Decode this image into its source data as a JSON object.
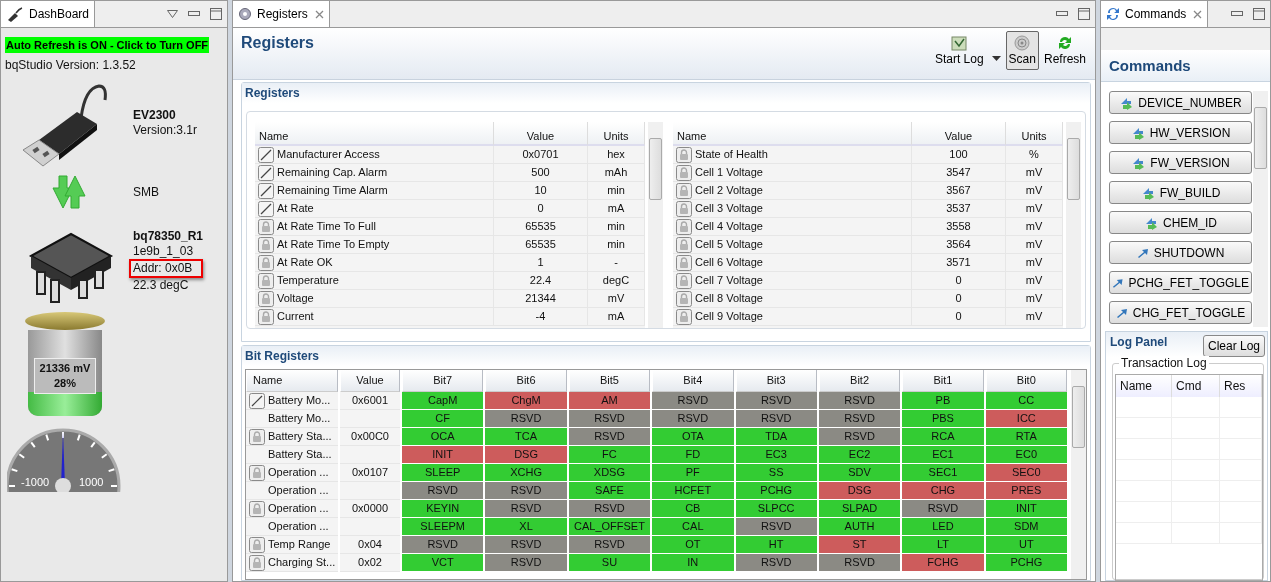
{
  "dashboard": {
    "tab": {
      "label": "DashBoard",
      "selected": true
    },
    "auto_refresh": {
      "label": "Auto Refresh is ON - Click to Turn OFF",
      "on": true
    },
    "version": "bqStudio Version:  1.3.52",
    "adapter": {
      "name": "EV2300",
      "version": "Version:3.1r"
    },
    "bus": "SMB",
    "device": {
      "name": "bq78350_R1",
      "firmware": "1e9b_1_03",
      "address": {
        "text": "Addr: 0x0B",
        "highlighted": true
      },
      "temperature": "22.3 degC"
    },
    "battery": {
      "voltage": "21336 mV",
      "charge": "28%",
      "level": 0.28
    },
    "gauge": {
      "labels": [
        "-1000",
        "1000"
      ]
    }
  },
  "registers_view": {
    "tab": {
      "label": "Registers",
      "selected": true
    },
    "title": "Registers",
    "toolbar": [
      {
        "label": "Start Log",
        "kind": "log",
        "pressed": false,
        "has_menu": true
      },
      {
        "label": "Scan",
        "kind": "scan",
        "pressed": true,
        "has_menu": false
      },
      {
        "label": "Refresh",
        "kind": "refresh",
        "pressed": false,
        "has_menu": false
      }
    ],
    "registers": {
      "title": "Registers",
      "tables": [
        {
          "columns": [
            "Name",
            "Value",
            "Units"
          ],
          "rows": [
            {
              "kind": "writable",
              "name": "Manufacturer Access",
              "value": "0x0701",
              "units": "hex"
            },
            {
              "kind": "writable",
              "name": "Remaining Cap. Alarm",
              "value": "500",
              "units": "mAh"
            },
            {
              "kind": "writable",
              "name": "Remaining Time Alarm",
              "value": "10",
              "units": "min"
            },
            {
              "kind": "writable",
              "name": "At Rate",
              "value": "0",
              "units": "mA"
            },
            {
              "kind": "locked",
              "name": "At Rate Time To Full",
              "value": "65535",
              "units": "min"
            },
            {
              "kind": "locked",
              "name": "At Rate Time To Empty",
              "value": "65535",
              "units": "min"
            },
            {
              "kind": "locked",
              "name": "At Rate OK",
              "value": "1",
              "units": "-"
            },
            {
              "kind": "locked",
              "name": "Temperature",
              "value": "22.4",
              "units": "degC"
            },
            {
              "kind": "locked",
              "name": "Voltage",
              "value": "21344",
              "units": "mV"
            },
            {
              "kind": "locked",
              "name": "Current",
              "value": "-4",
              "units": "mA"
            }
          ]
        },
        {
          "columns": [
            "Name",
            "Value",
            "Units"
          ],
          "rows": [
            {
              "kind": "locked",
              "name": "State of Health",
              "value": "100",
              "units": "%"
            },
            {
              "kind": "locked",
              "name": "Cell 1 Voltage",
              "value": "3547",
              "units": "mV"
            },
            {
              "kind": "locked",
              "name": "Cell 2 Voltage",
              "value": "3567",
              "units": "mV"
            },
            {
              "kind": "locked",
              "name": "Cell 3 Voltage",
              "value": "3537",
              "units": "mV"
            },
            {
              "kind": "locked",
              "name": "Cell 4 Voltage",
              "value": "3558",
              "units": "mV"
            },
            {
              "kind": "locked",
              "name": "Cell 5 Voltage",
              "value": "3564",
              "units": "mV"
            },
            {
              "kind": "locked",
              "name": "Cell 6 Voltage",
              "value": "3571",
              "units": "mV"
            },
            {
              "kind": "locked",
              "name": "Cell 7 Voltage",
              "value": "0",
              "units": "mV"
            },
            {
              "kind": "locked",
              "name": "Cell 8 Voltage",
              "value": "0",
              "units": "mV"
            },
            {
              "kind": "locked",
              "name": "Cell 9 Voltage",
              "value": "0",
              "units": "mV"
            }
          ]
        }
      ]
    },
    "bit_registers": {
      "title": "Bit Registers",
      "columns": [
        "Name",
        "Value",
        "Bit7",
        "Bit6",
        "Bit5",
        "Bit4",
        "Bit3",
        "Bit2",
        "Bit1",
        "Bit0"
      ],
      "rows": [
        {
          "kind": "writable",
          "name": "Battery Mo...",
          "value": "0x6001",
          "bits": [
            {
              "label": "CapM",
              "color": "#33cc33"
            },
            {
              "label": "ChgM",
              "color": "#cd5c5c"
            },
            {
              "label": "AM",
              "color": "#cd5c5c"
            },
            {
              "label": "RSVD",
              "color": "#8b8a84"
            },
            {
              "label": "RSVD",
              "color": "#8b8a84"
            },
            {
              "label": "RSVD",
              "color": "#8b8a84"
            },
            {
              "label": "PB",
              "color": "#33cc33"
            },
            {
              "label": "CC",
              "color": "#33cc33"
            }
          ]
        },
        {
          "kind": "continuation",
          "name": "Battery Mo...",
          "bits": [
            {
              "label": "CF",
              "color": "#33cc33"
            },
            {
              "label": "RSVD",
              "color": "#8b8a84"
            },
            {
              "label": "RSVD",
              "color": "#8b8a84"
            },
            {
              "label": "RSVD",
              "color": "#8b8a84"
            },
            {
              "label": "RSVD",
              "color": "#8b8a84"
            },
            {
              "label": "RSVD",
              "color": "#8b8a84"
            },
            {
              "label": "PBS",
              "color": "#33cc33"
            },
            {
              "label": "ICC",
              "color": "#cd5c5c"
            }
          ]
        },
        {
          "kind": "locked",
          "name": "Battery Sta...",
          "value": "0x00C0",
          "bits": [
            {
              "label": "OCA",
              "color": "#33cc33"
            },
            {
              "label": "TCA",
              "color": "#33cc33"
            },
            {
              "label": "RSVD",
              "color": "#8b8a84"
            },
            {
              "label": "OTA",
              "color": "#33cc33"
            },
            {
              "label": "TDA",
              "color": "#33cc33"
            },
            {
              "label": "RSVD",
              "color": "#8b8a84"
            },
            {
              "label": "RCA",
              "color": "#33cc33"
            },
            {
              "label": "RTA",
              "color": "#33cc33"
            }
          ]
        },
        {
          "kind": "continuation",
          "name": "Battery Sta...",
          "bits": [
            {
              "label": "INIT",
              "color": "#cd5c5c"
            },
            {
              "label": "DSG",
              "color": "#cd5c5c"
            },
            {
              "label": "FC",
              "color": "#33cc33"
            },
            {
              "label": "FD",
              "color": "#33cc33"
            },
            {
              "label": "EC3",
              "color": "#33cc33"
            },
            {
              "label": "EC2",
              "color": "#33cc33"
            },
            {
              "label": "EC1",
              "color": "#33cc33"
            },
            {
              "label": "EC0",
              "color": "#33cc33"
            }
          ]
        },
        {
          "kind": "locked",
          "name": "Operation ...",
          "value": "0x0107",
          "bits": [
            {
              "label": "SLEEP",
              "color": "#33cc33"
            },
            {
              "label": "XCHG",
              "color": "#33cc33"
            },
            {
              "label": "XDSG",
              "color": "#33cc33"
            },
            {
              "label": "PF",
              "color": "#33cc33"
            },
            {
              "label": "SS",
              "color": "#33cc33"
            },
            {
              "label": "SDV",
              "color": "#33cc33"
            },
            {
              "label": "SEC1",
              "color": "#33cc33"
            },
            {
              "label": "SEC0",
              "color": "#cd5c5c"
            }
          ]
        },
        {
          "kind": "continuation",
          "name": "Operation ...",
          "bits": [
            {
              "label": "RSVD",
              "color": "#8b8a84"
            },
            {
              "label": "RSVD",
              "color": "#8b8a84"
            },
            {
              "label": "SAFE",
              "color": "#33cc33"
            },
            {
              "label": "HCFET",
              "color": "#33cc33"
            },
            {
              "label": "PCHG",
              "color": "#33cc33"
            },
            {
              "label": "DSG",
              "color": "#cd5c5c"
            },
            {
              "label": "CHG",
              "color": "#cd5c5c"
            },
            {
              "label": "PRES",
              "color": "#cd5c5c"
            }
          ]
        },
        {
          "kind": "locked",
          "name": "Operation ...",
          "value": "0x0000",
          "bits": [
            {
              "label": "KEYIN",
              "color": "#33cc33"
            },
            {
              "label": "RSVD",
              "color": "#8b8a84"
            },
            {
              "label": "RSVD",
              "color": "#8b8a84"
            },
            {
              "label": "CB",
              "color": "#33cc33"
            },
            {
              "label": "SLPCC",
              "color": "#33cc33"
            },
            {
              "label": "SLPAD",
              "color": "#33cc33"
            },
            {
              "label": "RSVD",
              "color": "#8b8a84"
            },
            {
              "label": "INIT",
              "color": "#33cc33"
            }
          ]
        },
        {
          "kind": "continuation",
          "name": "Operation ...",
          "bits": [
            {
              "label": "SLEEPM",
              "color": "#33cc33"
            },
            {
              "label": "XL",
              "color": "#33cc33"
            },
            {
              "label": "CAL_OFFSET",
              "color": "#33cc33"
            },
            {
              "label": "CAL",
              "color": "#33cc33"
            },
            {
              "label": "RSVD",
              "color": "#8b8a84"
            },
            {
              "label": "AUTH",
              "color": "#33cc33"
            },
            {
              "label": "LED",
              "color": "#33cc33"
            },
            {
              "label": "SDM",
              "color": "#33cc33"
            }
          ]
        },
        {
          "kind": "locked",
          "name": "Temp Range",
          "value": "0x04",
          "bits": [
            {
              "label": "RSVD",
              "color": "#8b8a84"
            },
            {
              "label": "RSVD",
              "color": "#8b8a84"
            },
            {
              "label": "RSVD",
              "color": "#8b8a84"
            },
            {
              "label": "OT",
              "color": "#33cc33"
            },
            {
              "label": "HT",
              "color": "#33cc33"
            },
            {
              "label": "ST",
              "color": "#cd5c5c"
            },
            {
              "label": "LT",
              "color": "#33cc33"
            },
            {
              "label": "UT",
              "color": "#33cc33"
            }
          ]
        },
        {
          "kind": "locked",
          "name": "Charging St...",
          "value": "0x02",
          "bits": [
            {
              "label": "VCT",
              "color": "#33cc33"
            },
            {
              "label": "RSVD",
              "color": "#8b8a84"
            },
            {
              "label": "SU",
              "color": "#33cc33"
            },
            {
              "label": "IN",
              "color": "#33cc33"
            },
            {
              "label": "RSVD",
              "color": "#8b8a84"
            },
            {
              "label": "RSVD",
              "color": "#8b8a84"
            },
            {
              "label": "FCHG",
              "color": "#cd5c5c"
            },
            {
              "label": "PCHG",
              "color": "#33cc33"
            }
          ]
        }
      ]
    }
  },
  "commands_view": {
    "tab": {
      "label": "Commands",
      "selected": true
    },
    "title": "Commands",
    "buttons": [
      {
        "label": "DEVICE_NUMBER",
        "kind": "pair"
      },
      {
        "label": "HW_VERSION",
        "kind": "pair"
      },
      {
        "label": "FW_VERSION",
        "kind": "pair"
      },
      {
        "label": "FW_BUILD",
        "kind": "pair"
      },
      {
        "label": "CHEM_ID",
        "kind": "pair"
      },
      {
        "label": "SHUTDOWN",
        "kind": "single"
      },
      {
        "label": "PCHG_FET_TOGGLE",
        "kind": "single"
      },
      {
        "label": "CHG_FET_TOGGLE",
        "kind": "single"
      }
    ],
    "log_panel": {
      "title": "Log Panel",
      "clear_button": "Clear Log",
      "group": "Transaction Log",
      "columns": [
        "Name",
        "Cmd",
        "Res"
      ]
    }
  }
}
